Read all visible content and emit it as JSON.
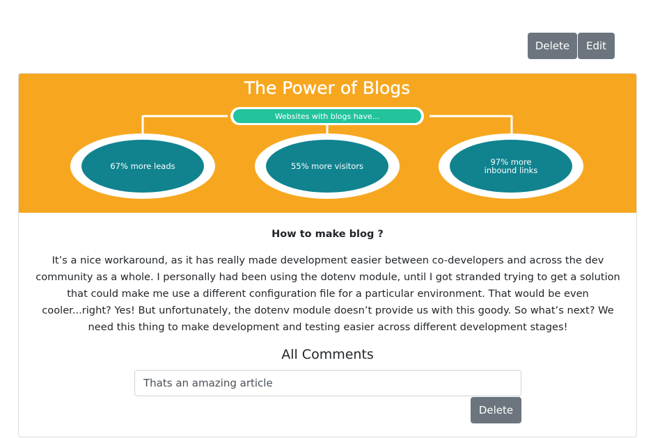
{
  "header_actions": {
    "delete_label": "Delete",
    "edit_label": "Edit"
  },
  "post": {
    "banner": {
      "heading": "The Power of Blogs",
      "pill": "Websites with blogs have...",
      "stats": [
        "67% more leads",
        "55% more visitors",
        "97% more",
        "inbound links"
      ],
      "colors": {
        "background": "#f7a71f",
        "circle": "#10838f",
        "pill": "#22c39d"
      }
    },
    "title": "How to make blog ?",
    "body": "It’s a nice workaround, as it has really made development easier between co-developers and across the dev community as a whole. I personally had been using the dotenv module, until I got stranded trying to get a solution that could make me use a different configuration file for a particular environment. That would be even cooler...right? Yes! But unfortunately, the dotenv module doesn’t provide us with this goody. So what’s next? We need this thing to make development and testing easier across different development stages!"
  },
  "comments": {
    "heading": "All Comments",
    "items": [
      {
        "text": "Thats an amazing article",
        "delete_label": "Delete"
      }
    ]
  }
}
